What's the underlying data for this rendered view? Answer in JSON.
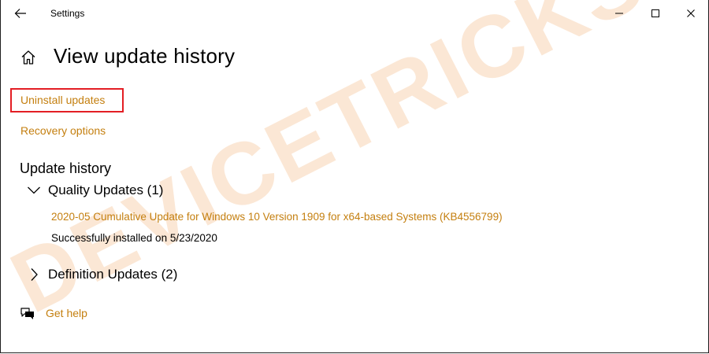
{
  "window": {
    "title": "Settings"
  },
  "icons": {
    "back": "back-arrow-icon",
    "home": "home-icon",
    "minimize": "minimize-icon",
    "maximize": "maximize-icon",
    "close": "close-icon",
    "expanded": "chevron-down-icon",
    "collapsed": "chevron-right-icon",
    "help": "help-chat-icon"
  },
  "colors": {
    "link": "#c47f0f",
    "highlight_box": "#e31e24",
    "watermark": "#fbe7d5"
  },
  "page": {
    "title": "View update history"
  },
  "links": {
    "uninstall_updates": "Uninstall updates",
    "recovery_options": "Recovery options"
  },
  "history": {
    "title": "Update history",
    "groups": [
      {
        "label": "Quality Updates (1)",
        "expanded": true,
        "items": [
          {
            "name": "2020-05 Cumulative Update for Windows 10 Version 1909 for x64-based Systems (KB4556799)",
            "status": "Successfully installed on 5/23/2020"
          }
        ]
      },
      {
        "label": "Definition Updates (2)",
        "expanded": false
      }
    ]
  },
  "help": {
    "label": "Get help"
  },
  "watermark": {
    "text": "DEVICETRICKS"
  }
}
